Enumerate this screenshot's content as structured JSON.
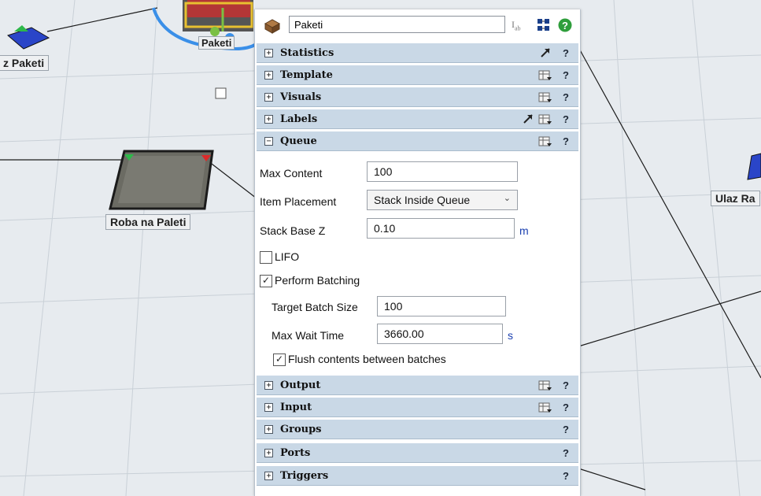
{
  "scene": {
    "labels": {
      "paketi": "Paketi",
      "izlaz_paketi": "z Paketi",
      "roba_na_paleti": "Roba na Paleti",
      "ulaz": "Ulaz Ra"
    }
  },
  "panel": {
    "object_name": "Paketi",
    "icons": {
      "object": "pallet-box-icon",
      "label_tool": "text-label-icon",
      "tree": "tree-view-icon",
      "help": "help-icon"
    },
    "sections_top": [
      {
        "id": "statistics",
        "label": "Statistics",
        "expand": "+",
        "help": "?"
      },
      {
        "id": "template",
        "label": "Template",
        "expand": "+",
        "help": "?"
      },
      {
        "id": "visuals",
        "label": "Visuals",
        "expand": "+",
        "help": "?"
      },
      {
        "id": "labels",
        "label": "Labels",
        "expand": "+",
        "help": "?"
      },
      {
        "id": "queue",
        "label": "Queue",
        "expand": "−",
        "help": "?"
      }
    ],
    "queue": {
      "max_content_label": "Max Content",
      "max_content_value": "100",
      "item_placement_label": "Item Placement",
      "item_placement_value": "Stack Inside Queue",
      "stack_base_z_label": "Stack Base Z",
      "stack_base_z_value": "0.10",
      "stack_base_z_unit": "m",
      "lifo_label": "LIFO",
      "lifo_checked": false,
      "perform_batching_label": "Perform Batching",
      "perform_batching_checked": true,
      "target_batch_size_label": "Target Batch Size",
      "target_batch_size_value": "100",
      "max_wait_time_label": "Max Wait Time",
      "max_wait_time_value": "3660.00",
      "max_wait_time_unit": "s",
      "flush_label": "Flush contents between batches",
      "flush_checked": true
    },
    "sections_bottom": [
      {
        "id": "output",
        "label": "Output",
        "expand": "+",
        "help": "?"
      },
      {
        "id": "input",
        "label": "Input",
        "expand": "+",
        "help": "?"
      },
      {
        "id": "groups",
        "label": "Groups",
        "expand": "+",
        "help": "?"
      },
      {
        "id": "ports",
        "label": "Ports",
        "expand": "+",
        "help": "?"
      },
      {
        "id": "triggers",
        "label": "Triggers",
        "expand": "+",
        "help": "?"
      }
    ]
  }
}
